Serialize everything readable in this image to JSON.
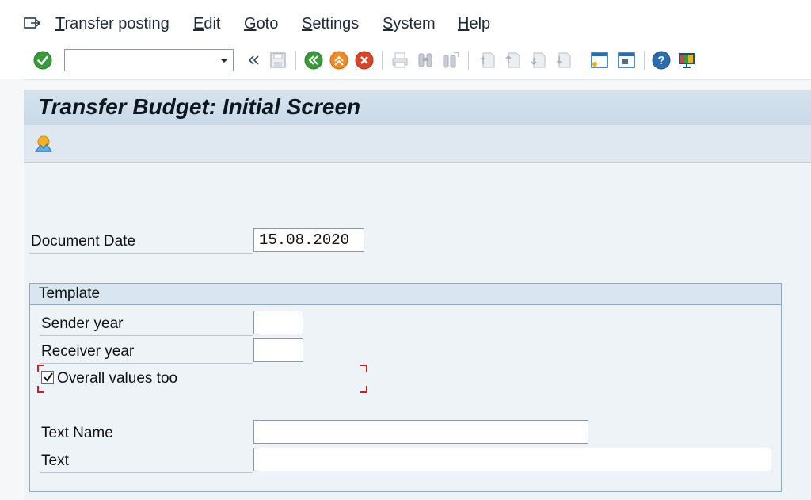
{
  "menubar": {
    "items": [
      {
        "label": "Transfer posting",
        "accel": "T",
        "rest": "ransfer posting"
      },
      {
        "label": "Edit",
        "accel": "E",
        "rest": "dit"
      },
      {
        "label": "Goto",
        "accel": "G",
        "rest": "oto"
      },
      {
        "label": "Settings",
        "accel": "S",
        "rest": "ettings"
      },
      {
        "label": "System",
        "accel": "S",
        "rest": "ystem"
      },
      {
        "label": "Help",
        "accel": "H",
        "rest": "elp"
      }
    ]
  },
  "toolbar": {
    "command_field_value": "",
    "icons": [
      "enter-icon",
      "command-dropdown-icon",
      "collapse-icon",
      "save-icon",
      "back-icon",
      "exit-icon",
      "cancel-icon",
      "print-icon",
      "find-icon",
      "find-next-icon",
      "first-page-icon",
      "previous-page-icon",
      "next-page-icon",
      "last-page-icon",
      "create-session-icon",
      "generate-shortcut-icon",
      "help-icon",
      "customize-layout-icon"
    ]
  },
  "screen": {
    "title": "Transfer Budget: Initial Screen"
  },
  "form": {
    "document_date_label": "Document Date",
    "document_date_value": "15.08.2020",
    "template": {
      "title": "Template",
      "sender_year_label": "Sender year",
      "sender_year_value": "",
      "receiver_year_label": "Receiver year",
      "receiver_year_value": "",
      "overall_values_label": "Overall values too",
      "overall_values_checked": true,
      "text_name_label": "Text Name",
      "text_name_value": "",
      "text_label": "Text",
      "text_value": ""
    }
  },
  "colors": {
    "accent_green": "#3a9a3a",
    "accent_orange": "#f08a24",
    "accent_red": "#d9452b",
    "accent_blue": "#2b6cb0",
    "focus_red": "#e0161d",
    "title_bar": "#c9d9e8"
  }
}
